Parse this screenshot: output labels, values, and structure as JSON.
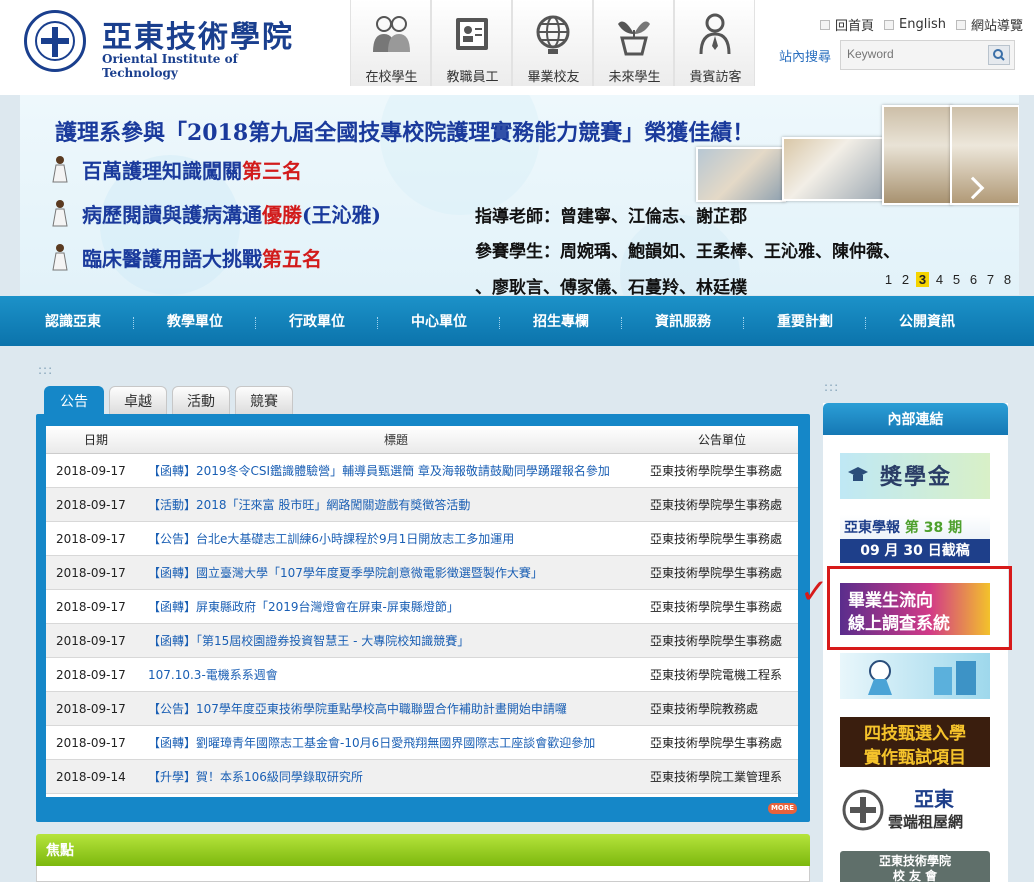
{
  "header": {
    "school_name": "亞東技術學院",
    "school_name_en": "Oriental Institute of Technology",
    "quick_links": [
      {
        "label": "在校學生",
        "icon": "students-icon"
      },
      {
        "label": "教職員工",
        "icon": "id-card-icon"
      },
      {
        "label": "畢業校友",
        "icon": "globe-icon"
      },
      {
        "label": "未來學生",
        "icon": "sprout-icon"
      },
      {
        "label": "貴賓訪客",
        "icon": "visitor-icon"
      }
    ],
    "top_links": [
      "回首頁",
      "English",
      "網站導覽"
    ],
    "search_label": "站內搜尋",
    "search_placeholder": "Keyword"
  },
  "banner": {
    "title": "護理系參與「2018第九屆全國技專校院護理實務能力競賽」榮獲佳績！",
    "awards": [
      {
        "text": "百萬護理知識闖關",
        "highlight": "第三名",
        "suffix": ""
      },
      {
        "text": "病歷閱讀與護病溝通",
        "highlight": "優勝",
        "suffix": "(王沁雅)"
      },
      {
        "text": "臨床醫護用語大挑戰",
        "highlight": "第五名",
        "suffix": ""
      }
    ],
    "teachers": "指導老師：曾建寧、江倫志、謝芷郡",
    "students_line1": "參賽學生：周婉瑀、鮑韻如、王柔棒、王沁雅、陳仲薇、",
    "students_line2": "、廖耿言、傅家儀、石蔓羚、林廷樸",
    "pager": [
      "1",
      "2",
      "3",
      "4",
      "5",
      "6",
      "7",
      "8"
    ],
    "pager_active": 2
  },
  "nav": [
    "認識亞東",
    "教學單位",
    "行政單位",
    "中心單位",
    "招生專欄",
    "資訊服務",
    "重要計劃",
    "公開資訊"
  ],
  "dots": ":::",
  "news": {
    "tabs": [
      "公告",
      "卓越",
      "活動",
      "競賽"
    ],
    "active_tab": 0,
    "headers": {
      "date": "日期",
      "title": "標題",
      "unit": "公告單位"
    },
    "rows": [
      {
        "date": "2018-09-17",
        "title": "【函轉】2019冬令CSI鑑識體驗營」輔導員甄選簡 章及海報敬請鼓勵同學踴躍報名參加",
        "unit": "亞東技術學院學生事務處"
      },
      {
        "date": "2018-09-17",
        "title": "【活動】2018「汪來富 股市旺」網路闖關遊戲有獎徵答活動",
        "unit": "亞東技術學院學生事務處"
      },
      {
        "date": "2018-09-17",
        "title": "【公告】台北e大基礎志工訓練6小時課程於9月1日開放志工多加運用",
        "unit": "亞東技術學院學生事務處"
      },
      {
        "date": "2018-09-17",
        "title": "【函轉】國立臺灣大學「107學年度夏季學院創意微電影徵選暨製作大賽」",
        "unit": "亞東技術學院學生事務處"
      },
      {
        "date": "2018-09-17",
        "title": "【函轉】屏東縣政府「2019台灣燈會在屏東-屏東縣燈節」",
        "unit": "亞東技術學院學生事務處"
      },
      {
        "date": "2018-09-17",
        "title": "【函轉】「第15屆校園證券投資智慧王 - 大專院校知識競賽」",
        "unit": "亞東技術學院學生事務處"
      },
      {
        "date": "2018-09-17",
        "title": "107.10.3-電機系系週會",
        "unit": "亞東技術學院電機工程系"
      },
      {
        "date": "2018-09-17",
        "title": "【公告】107學年度亞東技術學院重點學校高中職聯盟合作補助計畫開始申請囉",
        "unit": "亞東技術學院教務處"
      },
      {
        "date": "2018-09-17",
        "title": "【函轉】劉曜璋青年國際志工基金會-10月6日愛飛翔無國界國際志工座談會歡迎參加",
        "unit": "亞東技術學院學生事務處"
      },
      {
        "date": "2018-09-14",
        "title": "【升學】賀！本系106級同學錄取研究所",
        "unit": "亞東技術學院工業管理系"
      }
    ],
    "more_label": "MORE"
  },
  "focus": {
    "title": "焦點"
  },
  "sidebar": {
    "title": "內部連結",
    "banners": [
      {
        "text": "獎學金"
      },
      {
        "line1": "亞東學報",
        "line1b": "第 38 期",
        "line2": "09 月 30 日截稿"
      },
      {
        "line1": "畢業生流向",
        "line2": "線上調查系統"
      },
      {
        "text": ""
      },
      {
        "line1": "四技甄選入學",
        "line2": "實作甄試項目"
      },
      {
        "line1": "亞東",
        "line2": "雲端租屋網"
      },
      {
        "line1": "亞東技術學院",
        "line2": "校 友 會"
      }
    ]
  },
  "annotation": {
    "check_mark": "✓"
  },
  "colors": {
    "primary_blue": "#1587c8",
    "nav_blue": "#0b73ab",
    "focus_green": "#7cb80e",
    "highlight_red": "#d71a1a"
  }
}
